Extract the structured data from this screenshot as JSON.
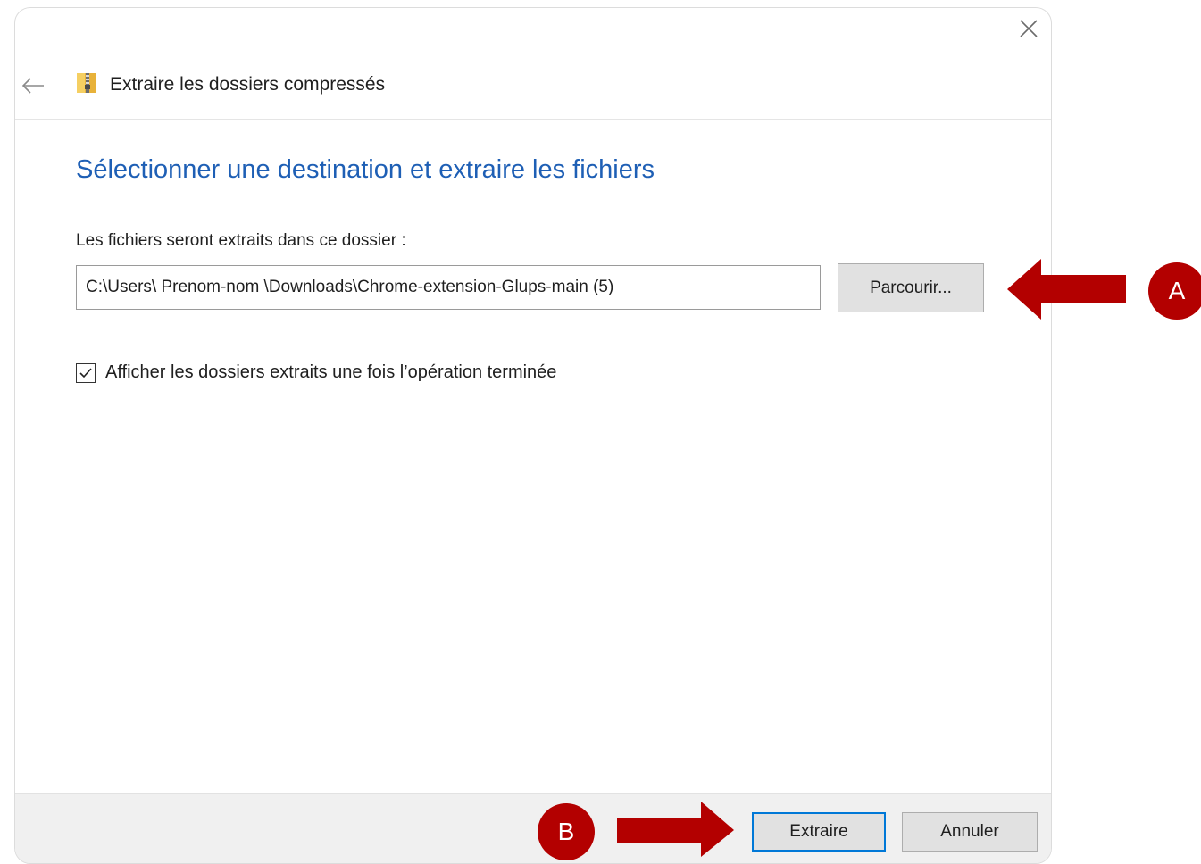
{
  "window": {
    "title": "Extraire les dossiers compressés",
    "close_icon": "close-icon",
    "back_icon": "arrow-left-icon",
    "app_icon": "zip-folder-icon"
  },
  "main": {
    "heading": "Sélectionner une destination et extraire les fichiers",
    "destination_label": "Les fichiers seront extraits dans ce dossier :",
    "destination_path": "C:\\Users\\ Prenom-nom \\Downloads\\Chrome-extension-Glups-main (5)",
    "browse_label": "Parcourir...",
    "show_extracted_label": "Afficher les dossiers extraits une fois l’opération terminée",
    "show_extracted_checked": true
  },
  "footer": {
    "extract_label": "Extraire",
    "cancel_label": "Annuler"
  },
  "annotations": {
    "a_label": "A",
    "b_label": "B",
    "color": "#b30000"
  },
  "colors": {
    "heading": "#1e5fb5",
    "default_button_border": "#0078d7"
  }
}
